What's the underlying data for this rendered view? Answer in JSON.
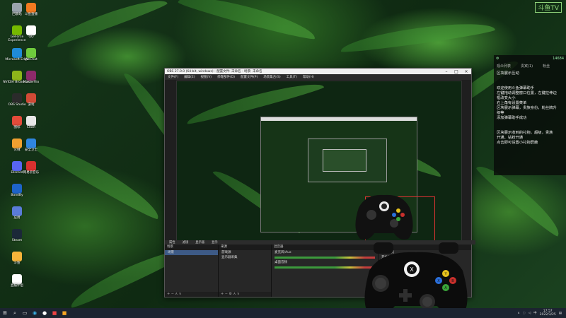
{
  "desktop": {
    "watermark": "斗鱼TV",
    "icons_col1": [
      {
        "label": "回收站",
        "color": "#9aa4ad",
        "icon": "recycle-bin-icon"
      },
      {
        "label": "GeForce Experience",
        "color": "#76b900",
        "icon": "geforce-icon"
      },
      {
        "label": "Microsoft Edge",
        "color": "#1f8bd8",
        "icon": "edge-icon"
      },
      {
        "label": "NVIDIA Broadcast",
        "color": "#8db51a",
        "icon": "nvidia-icon"
      },
      {
        "label": "OBS Studio",
        "color": "#2b2b2b",
        "icon": "obs-icon"
      },
      {
        "label": "图标",
        "color": "#e34b3a",
        "icon": "app-icon"
      },
      {
        "label": "火绒",
        "color": "#f0a030",
        "icon": "app-icon"
      },
      {
        "label": "Discord",
        "color": "#5865f2",
        "icon": "discord-icon"
      },
      {
        "label": "BandBy",
        "color": "#1e63c9",
        "icon": "app-icon"
      },
      {
        "label": "应用",
        "color": "#5a7bd9",
        "icon": "app-icon"
      },
      {
        "label": "Steam",
        "color": "#1b2838",
        "icon": "steam-icon"
      },
      {
        "label": "斗鱼",
        "color": "#f6b43a",
        "icon": "app-icon"
      },
      {
        "label": "直播伴侣",
        "color": "#ffffff",
        "icon": "app-icon"
      }
    ],
    "icons_col2": [
      {
        "label": "斗鱼直播",
        "color": "#f47a20",
        "icon": "douyu-icon"
      },
      {
        "label": "QQ",
        "color": "#ffffff",
        "icon": "qq-icon"
      },
      {
        "label": "WeChat",
        "color": "#6fcb3d",
        "icon": "wechat-icon"
      },
      {
        "label": "MasterRio",
        "color": "#8d2a6a",
        "icon": "app-icon"
      },
      {
        "label": "游戏",
        "color": "#d14a36",
        "icon": "app-icon"
      },
      {
        "label": "Clash",
        "color": "#e8e8e8",
        "icon": "app-icon"
      },
      {
        "label": "安全卫士",
        "color": "#2f86e0",
        "icon": "shield-icon"
      },
      {
        "label": "网易云音乐",
        "color": "#d8312f",
        "icon": "music-icon"
      }
    ]
  },
  "chat_panel": {
    "viewer_count": "14684",
    "tabs": [
      "观众列表",
      "贵宾(1)",
      "粉丝"
    ],
    "lines": [
      "区块展示互动"
    ],
    "messages": [
      "欢迎使用斗鱼弹幕助手",
      "左键拖动调整窗口位置，左键拉伸边",
      "框改变大小",
      "右上角有设置菜单",
      "区块展示弹幕，贵族身份，粉丝牌升",
      "级等",
      "添加弹幕助手成功"
    ],
    "messages2": [
      "区块展示收到的礼物，超级，贵族",
      "开通、钻粉开通",
      "点击即可设置小礼物屏蔽"
    ]
  },
  "obs": {
    "title": "OBS 27.0.0 (64-bit, windows) - 配置文件: 未命名 - 场景: 未命名",
    "menu": [
      "文件(F)",
      "编辑(E)",
      "视图(V)",
      "停靠部件(D)",
      "配置文件(P)",
      "场景集合(S)",
      "工具(T)",
      "帮助(H)"
    ],
    "toolbar": [
      "属性",
      "滤镜",
      "显示器",
      "显示"
    ],
    "scenes_header": "场景",
    "scenes": [
      "场景"
    ],
    "sources_header": "来源",
    "sources": [
      "游戏源",
      "显示器采集"
    ],
    "mixer_header": "混音器",
    "mixer_items": [
      {
        "name": "麦克风/Aux",
        "db": "0.0 dB"
      },
      {
        "name": "桌面音频",
        "db": "0.0 dB"
      }
    ],
    "controls_header": "控件",
    "controls": [
      "开始推流",
      "开始录制",
      "启动虚拟摄像机",
      "工作室模式",
      "设置",
      "退出"
    ]
  },
  "taskbar": {
    "time": "17:57",
    "date": "2022/3/25",
    "lang": "中"
  }
}
